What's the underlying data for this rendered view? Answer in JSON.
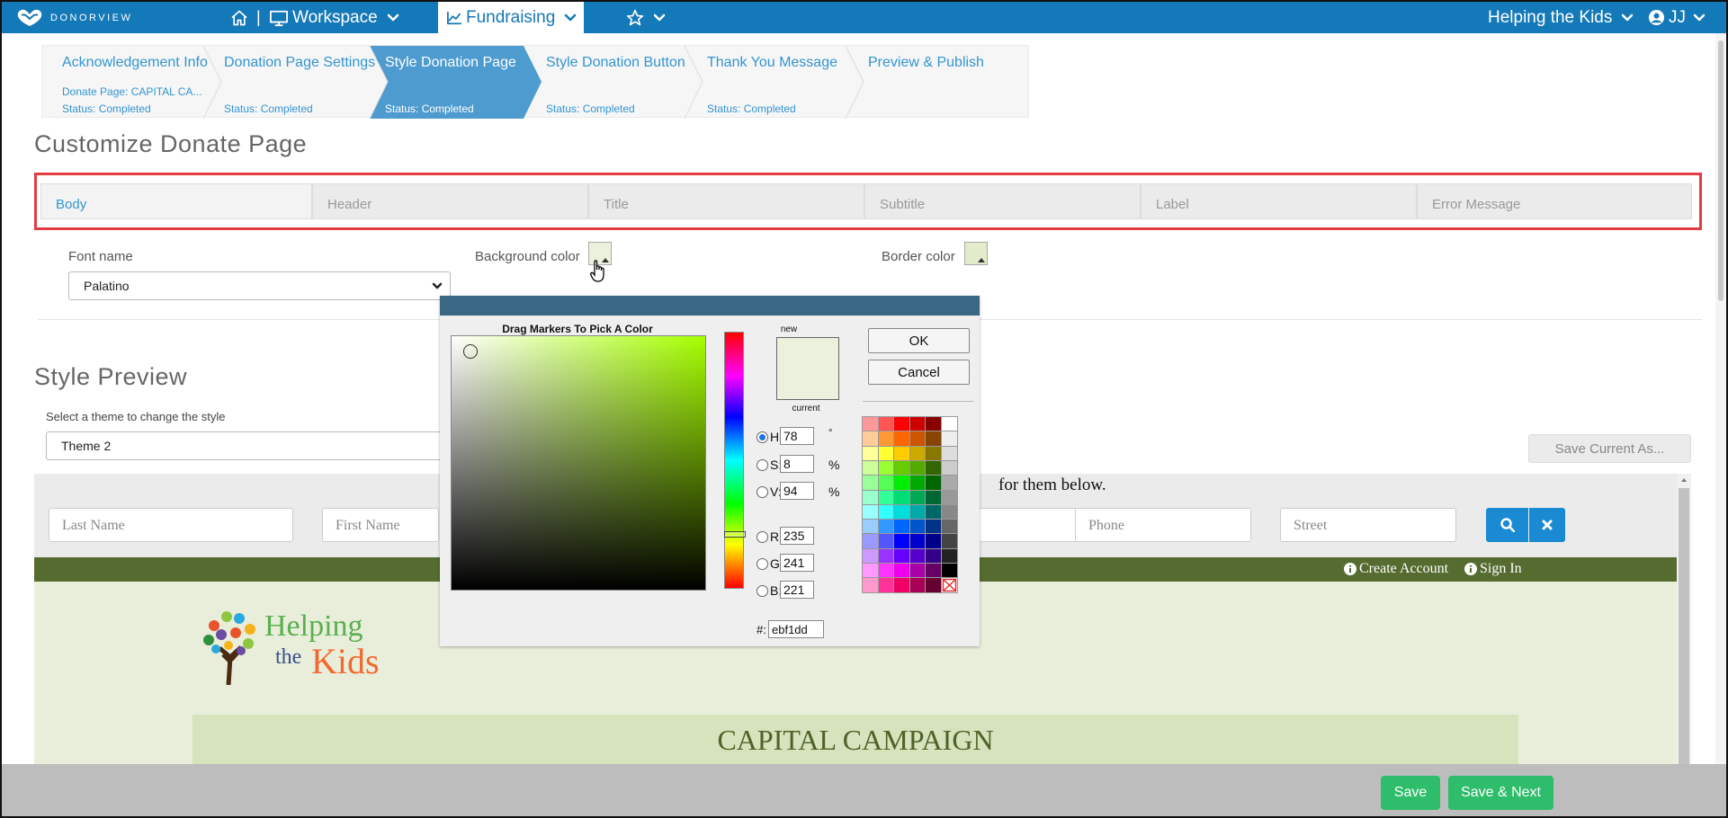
{
  "topbar": {
    "brand": "DONORVIEW",
    "separator": "|",
    "workspace_label": "Workspace",
    "fundraising_label": "Fundraising",
    "org_label": "Helping the Kids",
    "user_label": "JJ"
  },
  "wizard": {
    "steps": [
      {
        "title": "Acknowledgement Info",
        "detail": "Donate Page: CAPITAL CA...",
        "status": "Status: Completed"
      },
      {
        "title": "Donation Page Settings",
        "status": "Status: Completed"
      },
      {
        "title": "Style Donation Page",
        "status": "Status: Completed"
      },
      {
        "title": "Style Donation Button",
        "status": "Status: Completed"
      },
      {
        "title": "Thank You Message",
        "status": "Status: Completed"
      },
      {
        "title": "Preview & Publish"
      }
    ]
  },
  "customize": {
    "heading": "Customize Donate Page",
    "tabs": [
      "Body",
      "Header",
      "Title",
      "Subtitle",
      "Label",
      "Error Message"
    ],
    "font_name_label": "Font name",
    "font_name_value": "Palatino",
    "background_color_label": "Background color",
    "border_color_label": "Border color",
    "background_color": "#ebf1dd",
    "border_color": "#e2ebcb"
  },
  "color_picker": {
    "instruction": "Drag Markers To Pick A Color",
    "new_label": "new",
    "current_label": "current",
    "ok_label": "OK",
    "cancel_label": "Cancel",
    "h_label": "H:",
    "h_value": "78",
    "h_unit": "°",
    "s_label": "S:",
    "s_value": "8",
    "s_unit": "%",
    "v_label": "V:",
    "v_value": "94",
    "v_unit": "%",
    "r_label": "R:",
    "r_value": "235",
    "g_label": "G:",
    "g_value": "241",
    "b_label": "B:",
    "b_value": "221",
    "hex_label": "#:",
    "hex_value": "ebf1dd",
    "new_color": "#ebf1dd",
    "current_color": "#ebf1dd",
    "palette": [
      [
        "#ff9999",
        "#ff5555",
        "#ff0000",
        "#cc0000",
        "#880000",
        "#ffffff"
      ],
      [
        "#ffcc99",
        "#ff9933",
        "#ff6600",
        "#cc5500",
        "#884400",
        "#eeeeee"
      ],
      [
        "#ffff99",
        "#ffff33",
        "#ffcc00",
        "#ccaa00",
        "#887700",
        "#dddddd"
      ],
      [
        "#ccff99",
        "#99ff33",
        "#66cc00",
        "#55aa00",
        "#336600",
        "#cccccc"
      ],
      [
        "#99ff99",
        "#55ff55",
        "#00ee00",
        "#00aa00",
        "#006600",
        "#aaaaaa"
      ],
      [
        "#99ffcc",
        "#33ff99",
        "#00dd77",
        "#00aa55",
        "#006633",
        "#999999"
      ],
      [
        "#99ffff",
        "#33ffff",
        "#00dddd",
        "#00aaaa",
        "#006666",
        "#888888"
      ],
      [
        "#99ccff",
        "#3399ff",
        "#0066ff",
        "#0055cc",
        "#003388",
        "#666666"
      ],
      [
        "#9999ff",
        "#5555ff",
        "#0000ff",
        "#0000cc",
        "#000088",
        "#444444"
      ],
      [
        "#cc99ff",
        "#9933ff",
        "#6600ff",
        "#5500cc",
        "#330088",
        "#222222"
      ],
      [
        "#ff99ff",
        "#ff33ff",
        "#ee00ee",
        "#aa00aa",
        "#660066",
        "#000000"
      ],
      [
        "#ff99cc",
        "#ff3399",
        "#ee0066",
        "#aa0055",
        "#660033",
        "none"
      ]
    ]
  },
  "style_preview": {
    "heading": "Style Preview",
    "theme_label": "Select a theme to change the style",
    "theme_value": "Theme 2",
    "save_current_label": "Save Current As...",
    "search_text": "for them below.",
    "placeholders": {
      "last_name": "Last Name",
      "first_name": "First Name",
      "phone": "Phone",
      "street": "Street"
    },
    "create_account": "Create Account",
    "sign_in": "Sign In",
    "logo_word1": "Helping",
    "logo_word2": "the",
    "logo_word3": "Kids",
    "campaign_title": "CAPITAL CAMPAIGN"
  },
  "footer": {
    "save_label": "Save",
    "save_next_label": "Save & Next"
  }
}
